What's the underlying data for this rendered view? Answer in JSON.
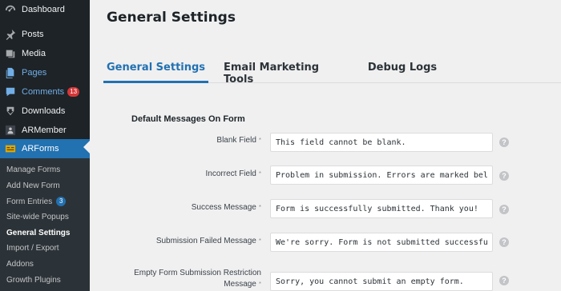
{
  "sidebar": {
    "items": [
      {
        "label": "Dashboard",
        "icon": "dashboard-icon"
      },
      {
        "label": "Posts",
        "icon": "pin-icon"
      },
      {
        "label": "Media",
        "icon": "media-icon"
      },
      {
        "label": "Pages",
        "icon": "pages-icon"
      },
      {
        "label": "Comments",
        "icon": "comment-icon",
        "badge": "13"
      },
      {
        "label": "Downloads",
        "icon": "download-icon"
      },
      {
        "label": "ARMember",
        "icon": "armember-icon"
      },
      {
        "label": "ARForms",
        "icon": "arforms-icon"
      }
    ],
    "submenu": [
      {
        "label": "Manage Forms"
      },
      {
        "label": "Add New Form"
      },
      {
        "label": "Form Entries",
        "badge": "3"
      },
      {
        "label": "Site-wide Popups"
      },
      {
        "label": "General Settings"
      },
      {
        "label": "Import / Export"
      },
      {
        "label": "Addons"
      },
      {
        "label": "Growth Plugins"
      }
    ]
  },
  "page": {
    "title": "General Settings",
    "tabs": [
      {
        "label": "General Settings"
      },
      {
        "label": "Email Marketing Tools"
      },
      {
        "label": "Debug Logs"
      }
    ],
    "section_heading": "Default Messages On Form",
    "required_mark": "*",
    "help_glyph": "?",
    "fields": [
      {
        "label": "Blank Field",
        "value": "This field cannot be blank."
      },
      {
        "label": "Incorrect Field",
        "value": "Problem in submission. Errors are marked below."
      },
      {
        "label": "Success Message",
        "value": "Form is successfully submitted. Thank you!"
      },
      {
        "label": "Submission Failed Message",
        "value": "We're sorry. Form is not submitted successfully."
      },
      {
        "label_line1": "Empty Form Submission Restriction",
        "label_line2": "Message",
        "value": "Sorry, you cannot submit an empty form."
      }
    ]
  },
  "colors": {
    "sidebar_bg": "#1d2327",
    "submenu_bg": "#2c3338",
    "accent": "#2271b1",
    "badge_red": "#d63638",
    "content_bg": "#f0f0f1"
  }
}
